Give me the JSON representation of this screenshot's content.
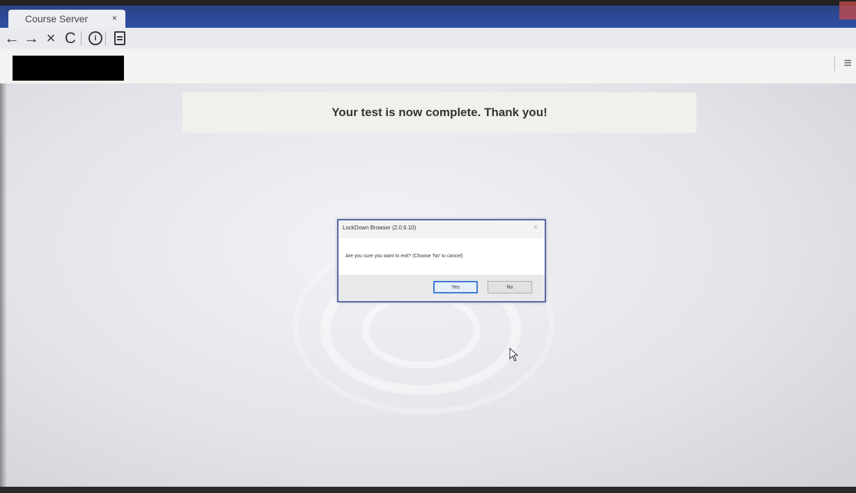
{
  "browser": {
    "tab_title": "Course Server",
    "tab_close": "×",
    "nav": {
      "back": "←",
      "forward": "→",
      "stop": "×",
      "reload": "C",
      "info": "i"
    },
    "menu_icon": "≡"
  },
  "page": {
    "banner_text": "Your test is now complete. Thank you!"
  },
  "dialog": {
    "title": "LockDown Browser (2.0.6.10)",
    "close": "×",
    "message": "Are you sure you want to exit?  (Choose 'No' to cancel)",
    "yes_label": "Yes",
    "no_label": "No"
  },
  "colors": {
    "tabstrip": "#2f4fa6",
    "dialog_border": "#5566a8",
    "default_button_border": "#3b78d8"
  }
}
